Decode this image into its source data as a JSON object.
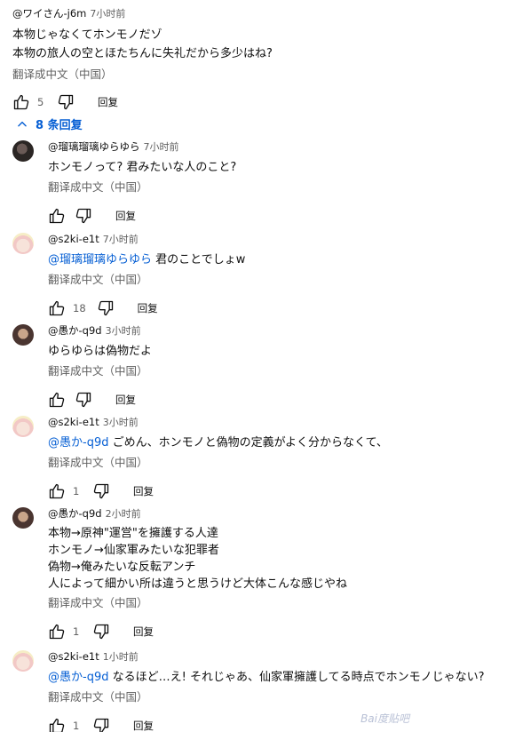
{
  "top_comment": {
    "author": "@ワイさん-j6m",
    "time": "7小时前",
    "text": "本物じゃなくてホンモノだゾ\n本物の旅人の空とほたちんに失礼だから多少はね?",
    "translate": "翻译成中文（中国）",
    "likes": "5",
    "reply_label": "回复"
  },
  "replies_toggle": {
    "label": "8 条回复"
  },
  "replies": [
    {
      "author": "@瑠璃瑠璃ゆらゆら",
      "time": "7小时前",
      "mention": "",
      "text": "ホンモノって? 君みたいな人のこと?",
      "translate": "翻译成中文（中国）",
      "likes": "",
      "reply_label": "回复"
    },
    {
      "author": "@s2ki-e1t",
      "time": "7小时前",
      "mention": "@瑠璃瑠璃ゆらゆら",
      "text": "君のことでしょw",
      "translate": "翻译成中文（中国）",
      "likes": "18",
      "reply_label": "回复"
    },
    {
      "author": "@愚か-q9d",
      "time": "3小时前",
      "mention": "",
      "text": "ゆらゆらは偽物だよ",
      "translate": "翻译成中文（中国）",
      "likes": "",
      "reply_label": "回复"
    },
    {
      "author": "@s2ki-e1t",
      "time": "3小时前",
      "mention": "@愚か-q9d",
      "text": "ごめん、ホンモノと偽物の定義がよく分からなくて、",
      "translate": "翻译成中文（中国）",
      "likes": "1",
      "reply_label": "回复"
    },
    {
      "author": "@愚か-q9d",
      "time": "2小时前",
      "mention": "",
      "text": "本物→原神\"運営\"を擁護する人達\nホンモノ→仙家軍みたいな犯罪者\n偽物→俺みたいな反転アンチ\n人によって細かい所は違うと思うけど大体こんな感じやね",
      "translate": "翻译成中文（中国）",
      "likes": "1",
      "reply_label": "回复"
    },
    {
      "author": "@s2ki-e1t",
      "time": "1小时前",
      "mention": "@愚か-q9d",
      "text": "なるほど…え! それじゃあ、仙家軍擁護してる時点でホンモノじゃない?",
      "translate": "翻译成中文（中国）",
      "likes": "1",
      "reply_label": "回复"
    }
  ],
  "watermark": "Bai度贴吧"
}
